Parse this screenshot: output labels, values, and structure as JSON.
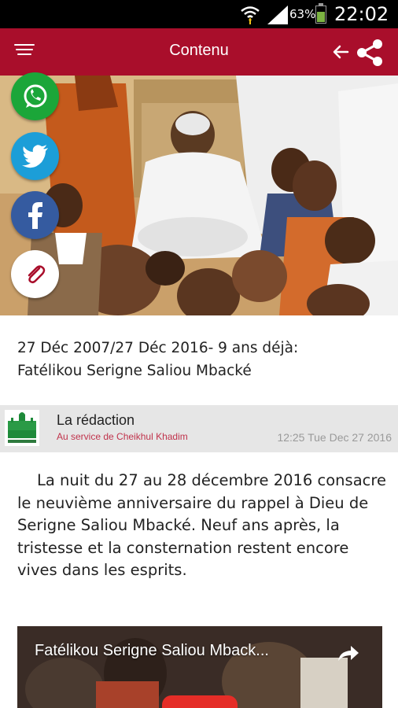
{
  "status_bar": {
    "battery_percent": "63%",
    "time": "22:02"
  },
  "app_bar": {
    "title": "Contenu"
  },
  "article": {
    "headline_line1": "27 Déc 2007/27 Déc 2016- 9 ans déjà:",
    "headline_line2": "Fatélikou Serigne Saliou Mbacké",
    "author": {
      "name": "La rédaction",
      "tagline": "Au service de Cheikhul Khadim",
      "date": "12:25 Tue Dec 27 2016"
    },
    "body": "La nuit du 27 au 28 décembre 2016 consacre le neuvième anniversaire du rappel à Dieu de Serigne Saliou Mbacké. Neuf ans après, la tristesse et la consternation restent encore vives dans les esprits.",
    "video": {
      "title": "Fatélikou Serigne Saliou Mback..."
    }
  },
  "share_buttons": [
    {
      "name": "whatsapp",
      "color": "#1ba639"
    },
    {
      "name": "twitter",
      "color": "#1c9ed8"
    },
    {
      "name": "facebook",
      "color": "#355ba0"
    },
    {
      "name": "copy-link",
      "color": "#ffffff"
    }
  ],
  "colors": {
    "app_bar": "#a90e2b",
    "author_tagline": "#c0334c",
    "author_bar": "#e6e6e6"
  }
}
